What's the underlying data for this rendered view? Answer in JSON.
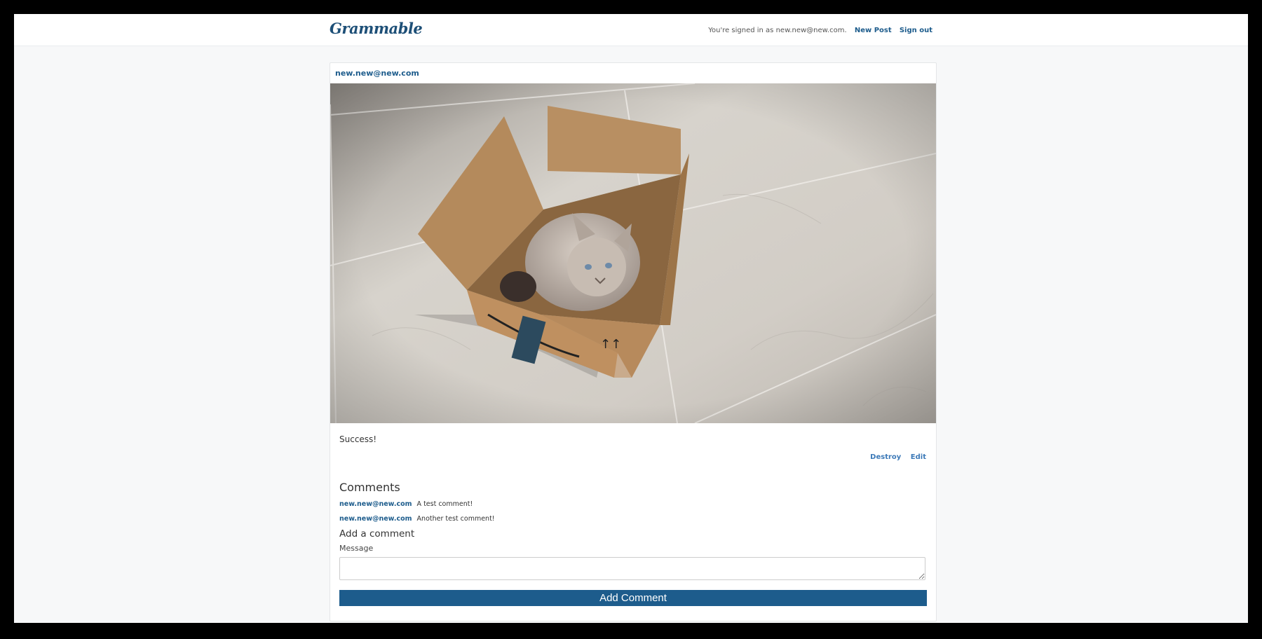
{
  "brand": "Grammable",
  "nav": {
    "signed_in_text": "You're signed in as new.new@new.com.",
    "new_post": "New Post",
    "sign_out": "Sign out"
  },
  "post": {
    "author": "new.new@new.com",
    "caption": "Success!",
    "actions": {
      "destroy": "Destroy",
      "edit": "Edit"
    }
  },
  "comments": {
    "title": "Comments",
    "items": [
      {
        "user": "new.new@new.com",
        "text": "A test comment!"
      },
      {
        "user": "new.new@new.com",
        "text": "Another test comment!"
      }
    ]
  },
  "form": {
    "title": "Add a comment",
    "label": "Message",
    "value": "",
    "submit": "Add Comment"
  }
}
